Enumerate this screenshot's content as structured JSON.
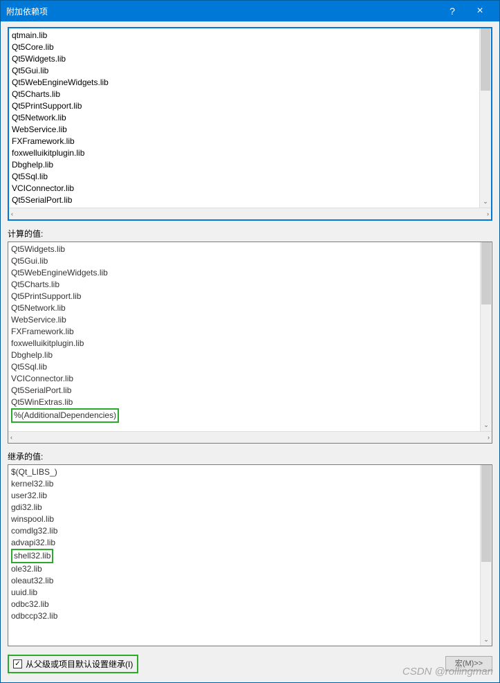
{
  "titlebar": {
    "title": "附加依赖项",
    "help": "?",
    "close": "×"
  },
  "editable": {
    "lines": [
      "qtmain.lib",
      "Qt5Core.lib",
      "Qt5Widgets.lib",
      "Qt5Gui.lib",
      "Qt5WebEngineWidgets.lib",
      "Qt5Charts.lib",
      "Qt5PrintSupport.lib",
      "Qt5Network.lib",
      "WebService.lib",
      "FXFramework.lib",
      "foxwelluikitplugin.lib",
      "Dbghelp.lib",
      "Qt5Sql.lib",
      "VCIConnector.lib",
      "Qt5SerialPort.lib"
    ]
  },
  "computed": {
    "label": "计算的值:",
    "lines": [
      "Qt5Widgets.lib",
      "Qt5Gui.lib",
      "Qt5WebEngineWidgets.lib",
      "Qt5Charts.lib",
      "Qt5PrintSupport.lib",
      "Qt5Network.lib",
      "WebService.lib",
      "FXFramework.lib",
      "foxwelluikitplugin.lib",
      "Dbghelp.lib",
      "Qt5Sql.lib",
      "VCIConnector.lib",
      "Qt5SerialPort.lib",
      "Qt5WinExtras.lib"
    ],
    "highlighted": "%(AdditionalDependencies)"
  },
  "inherited": {
    "label": "继承的值:",
    "lines": [
      "$(Qt_LIBS_)",
      "kernel32.lib",
      "user32.lib",
      "gdi32.lib",
      "winspool.lib",
      "comdlg32.lib",
      "advapi32.lib"
    ],
    "highlighted": "shell32.lib",
    "lines_after": [
      "ole32.lib",
      "oleaut32.lib",
      "uuid.lib",
      "odbc32.lib",
      "odbccp32.lib"
    ]
  },
  "footer": {
    "checkbox_label": "从父级或项目默认设置继承(I)",
    "checkbox_checked": "✓",
    "macro_button": "宏(M)>>"
  },
  "scroll": {
    "down": "⌄",
    "left": "‹",
    "right": "›"
  },
  "watermark": "CSDN @rollingman"
}
